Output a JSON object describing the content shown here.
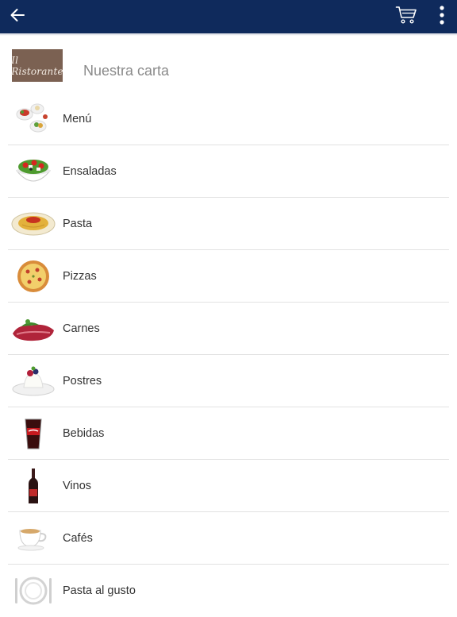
{
  "app": {
    "title": "Nuestra carta",
    "logo_text": "Il Ristorante",
    "colors": {
      "topbar": "#0f2a5c",
      "logo_bg": "#7b6152",
      "title": "#8a8a8a",
      "divider": "#e2e2e2"
    }
  },
  "toolbar": {
    "back_icon": "arrow-left-icon",
    "cart_icon": "shopping-cart-icon",
    "more_icon": "more-vertical-icon"
  },
  "menu": {
    "items": [
      {
        "label": "Menú",
        "icon": "menu-dishes-icon"
      },
      {
        "label": "Ensaladas",
        "icon": "salad-icon"
      },
      {
        "label": "Pasta",
        "icon": "pasta-icon"
      },
      {
        "label": "Pizzas",
        "icon": "pizza-icon"
      },
      {
        "label": "Carnes",
        "icon": "meat-icon"
      },
      {
        "label": "Postres",
        "icon": "dessert-icon"
      },
      {
        "label": "Bebidas",
        "icon": "soda-icon"
      },
      {
        "label": "Vinos",
        "icon": "wine-icon"
      },
      {
        "label": "Cafés",
        "icon": "coffee-icon"
      },
      {
        "label": "Pasta al gusto",
        "icon": "plate-icon"
      }
    ]
  }
}
